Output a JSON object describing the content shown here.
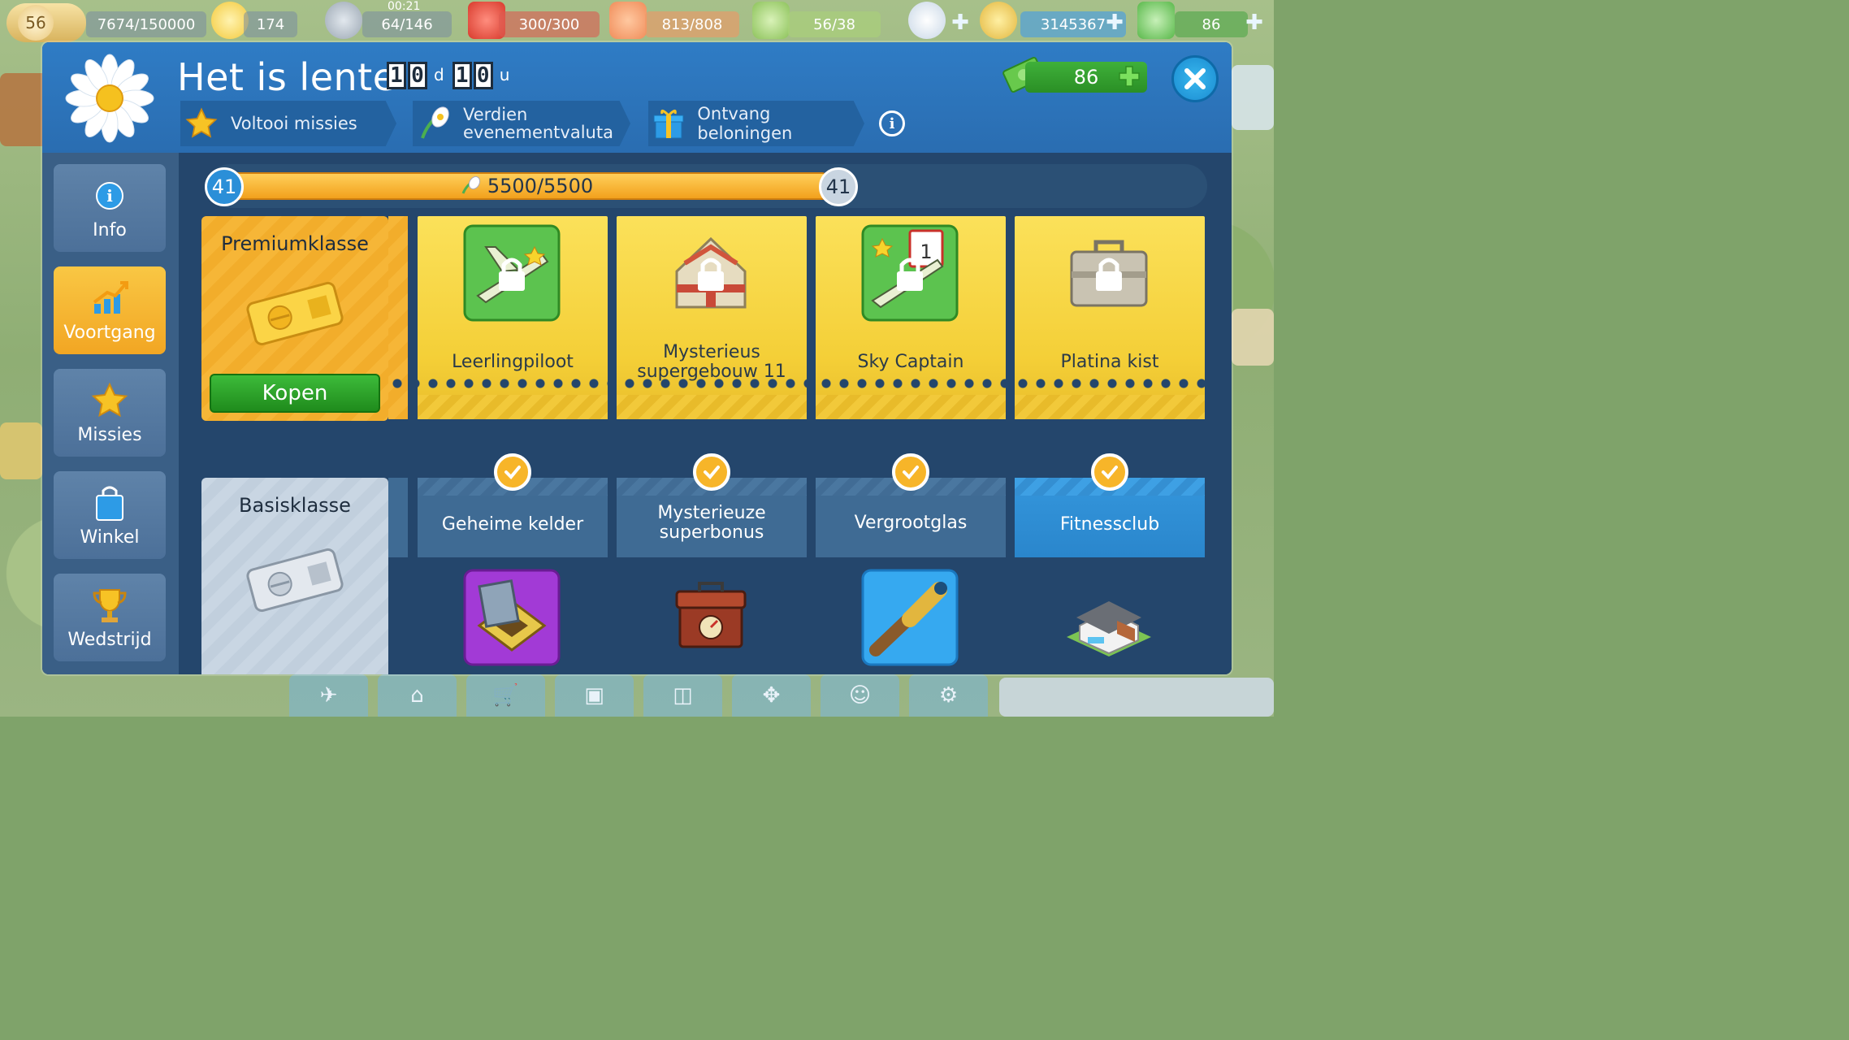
{
  "hud": {
    "level": "56",
    "xp": "7674/150000",
    "stars": "174",
    "time": "00:21",
    "fuel": "64/146",
    "fuel_cans": "300/300",
    "cargo": "813/808",
    "passengers": "56/38",
    "coins": "3145367",
    "cash": "86"
  },
  "modal": {
    "title": "Het is lente",
    "timer": {
      "days_digits": [
        "1",
        "0"
      ],
      "days_unit": "d",
      "hours_digits": [
        "1",
        "0"
      ],
      "hours_unit": "u"
    },
    "steps": [
      {
        "label": "Voltooi missies",
        "icon": "star-icon"
      },
      {
        "label": "Verdien evenementvaluta",
        "icon": "flower-icon"
      },
      {
        "label": "Ontvang beloningen",
        "icon": "gift-icon"
      }
    ],
    "cash": "86",
    "close_icon": "close-icon"
  },
  "sidebar": {
    "items": [
      {
        "label": "Info",
        "icon": "info-icon",
        "active": false
      },
      {
        "label": "Voortgang",
        "icon": "progress-chart-icon",
        "active": true
      },
      {
        "label": "Missies",
        "icon": "star-icon",
        "active": false
      },
      {
        "label": "Winkel",
        "icon": "shopping-bag-icon",
        "active": false
      },
      {
        "label": "Wedstrijd",
        "icon": "trophy-icon",
        "active": false
      }
    ]
  },
  "progress": {
    "level_start": "41",
    "level_end": "41",
    "value_text": "5500/5500",
    "fraction": 1.0
  },
  "classes": {
    "premium": {
      "title": "Premiumklasse",
      "buy_label": "Kopen"
    },
    "basic": {
      "title": "Basisklasse"
    }
  },
  "rewards": [
    {
      "premium": "Leerlingpiloot",
      "basic": "Geheime kelder",
      "premium_icon": "plane-stars-icon",
      "basic_icon": "secret-cellar-icon",
      "claimed": true
    },
    {
      "premium": "Mysterieus supergebouw 11",
      "basic": "Mysterieuze superbonus",
      "premium_icon": "mystery-building-icon",
      "basic_icon": "treasure-chest-icon",
      "claimed": true
    },
    {
      "premium": "Sky Captain",
      "basic": "Vergrootglas",
      "premium_icon": "plane-calendar-icon",
      "basic_icon": "spyglass-icon",
      "claimed": true
    },
    {
      "premium": "Platina kist",
      "basic": "Fitnessclub",
      "premium_icon": "platinum-case-icon",
      "basic_icon": "fitness-club-icon",
      "claimed": true
    }
  ],
  "colors": {
    "header_blue": "#2f7cc5",
    "premium_gold": "#f4cf37",
    "accent_green": "#3dbb3a",
    "check_orange": "#f7b529"
  }
}
